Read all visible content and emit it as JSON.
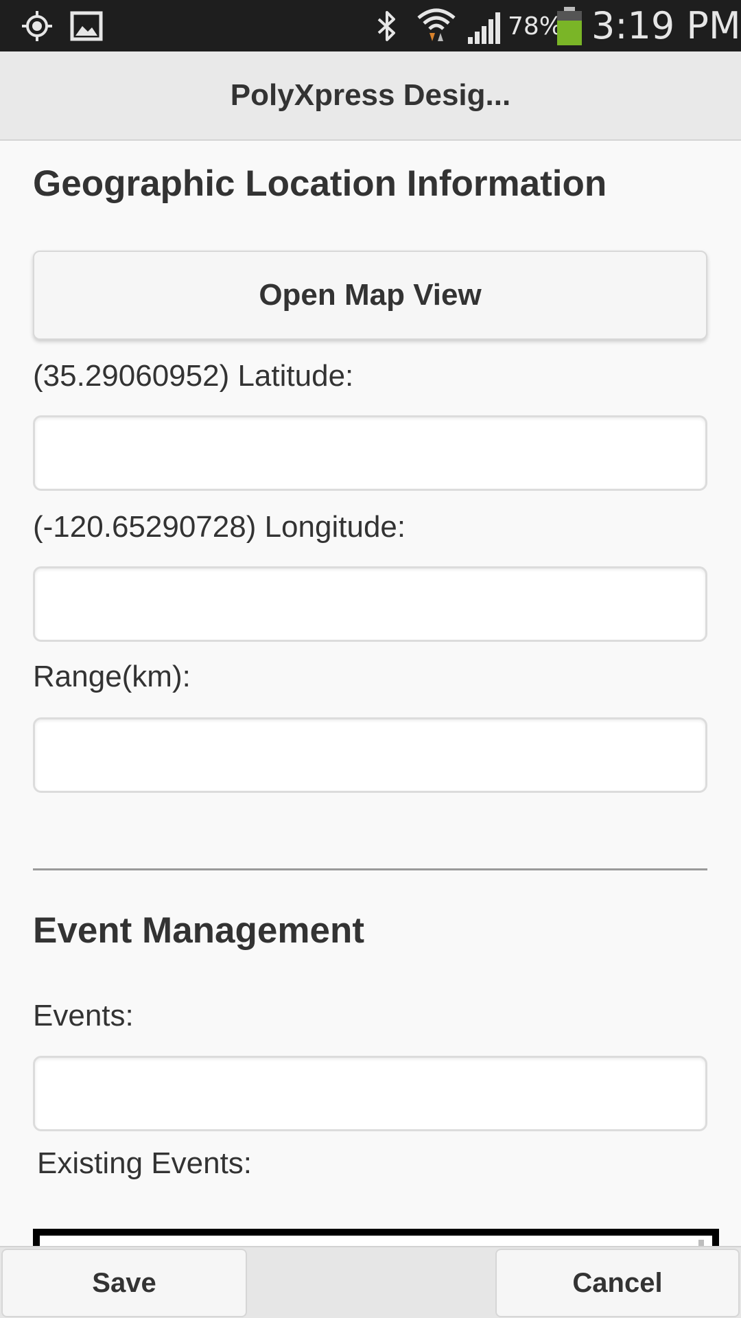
{
  "status_bar": {
    "battery_percent": "78%",
    "time": "3:19 PM",
    "icons": [
      "location-target-icon",
      "image-icon",
      "bluetooth-icon",
      "wifi-icon",
      "signal-icon",
      "battery-icon"
    ],
    "battery_color": "#7ab527"
  },
  "header": {
    "title": "PolyXpress Desig..."
  },
  "geo_section": {
    "heading": "Geographic Location Information",
    "open_map_label": "Open Map View",
    "latitude_label": "(35.29060952) Latitude:",
    "latitude_value": "",
    "longitude_label": "(-120.65290728) Longitude:",
    "longitude_value": "",
    "range_label": "Range(km):",
    "range_value": ""
  },
  "event_section": {
    "heading": "Event Management",
    "events_label": "Events:",
    "events_value": "",
    "existing_events_label": "Existing Events:"
  },
  "footer": {
    "save_label": "Save",
    "cancel_label": "Cancel"
  },
  "colors": {
    "status_bar_bg": "#1e1e1e",
    "header_bg": "#e9e9e9",
    "page_bg": "#f9f9f9",
    "text": "#333333"
  }
}
